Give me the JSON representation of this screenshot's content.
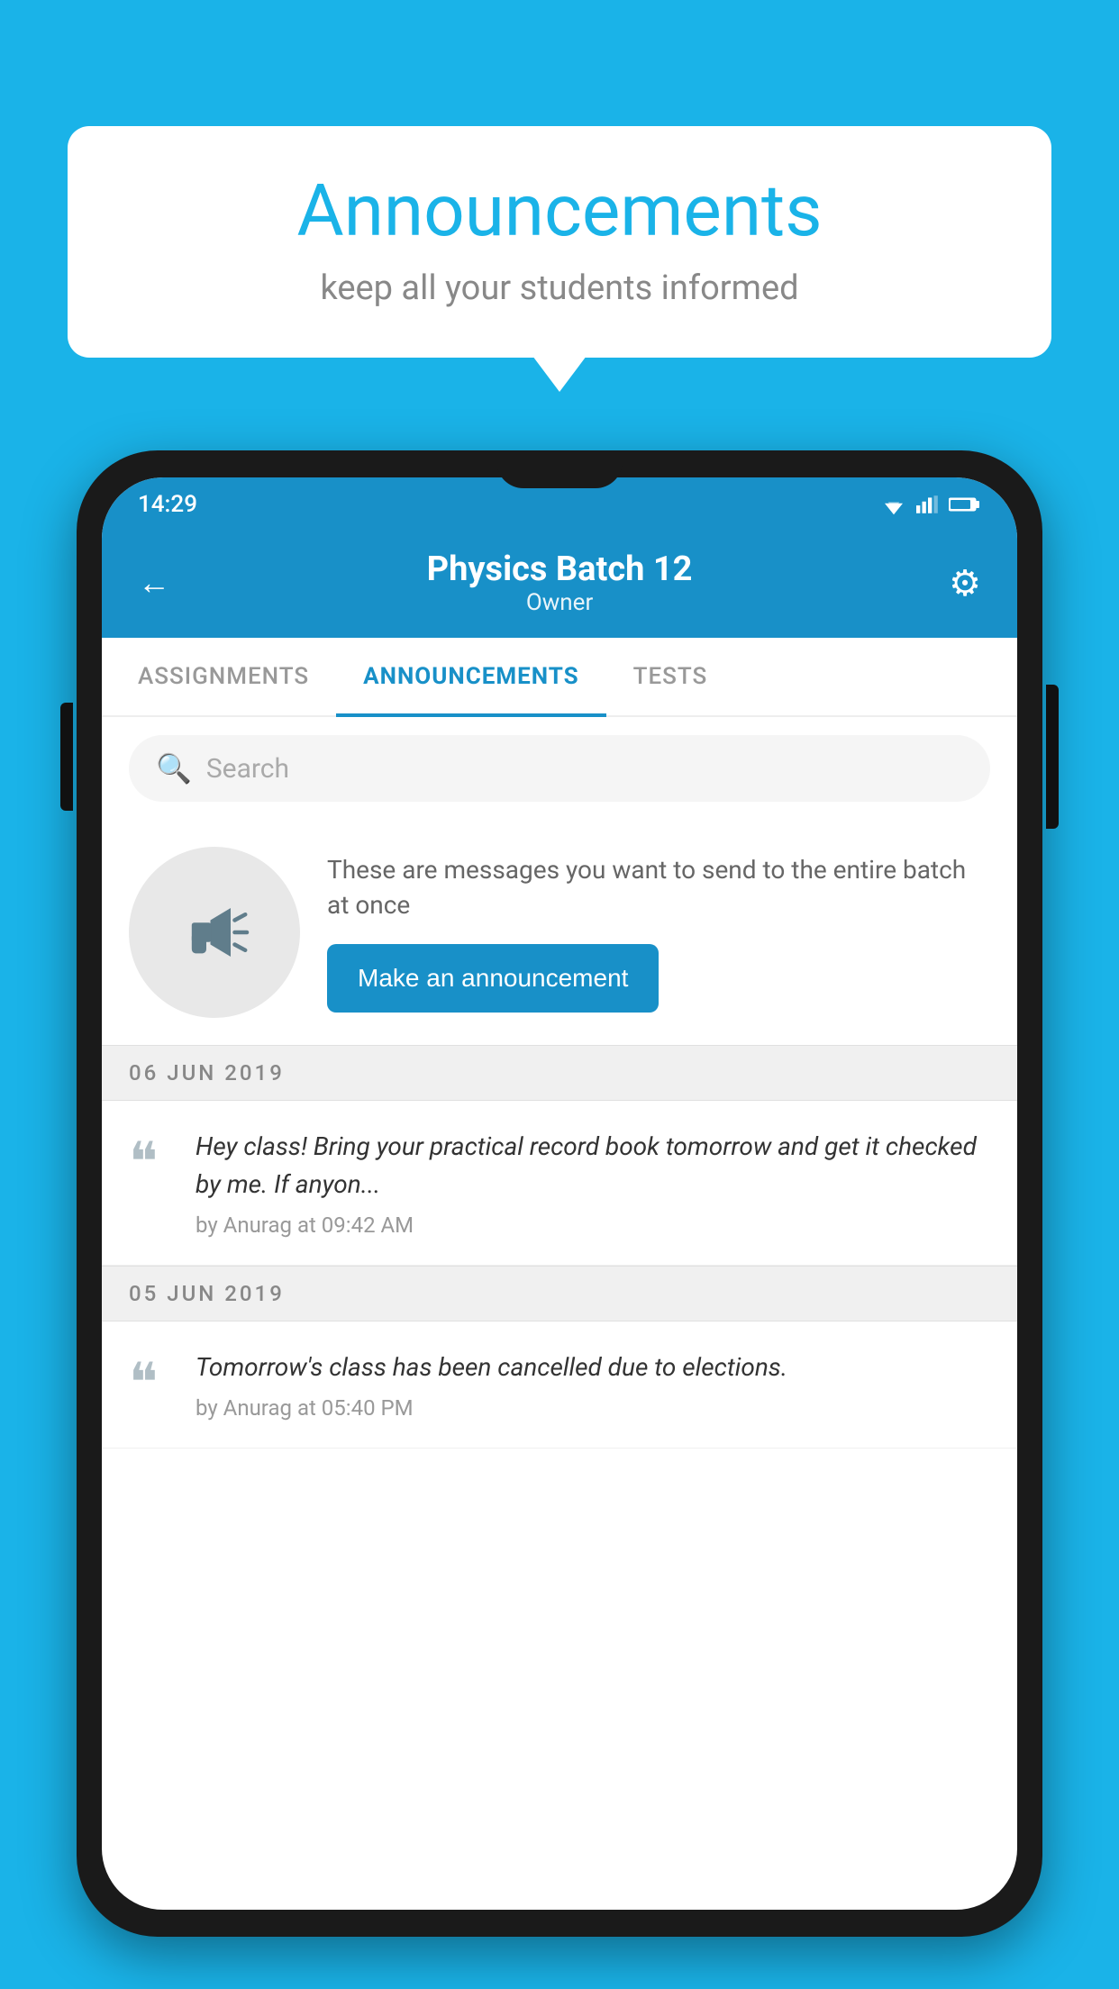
{
  "background_color": "#1ab3e8",
  "speech_bubble": {
    "title": "Announcements",
    "subtitle": "keep all your students informed"
  },
  "phone": {
    "status_bar": {
      "time": "14:29"
    },
    "header": {
      "title": "Physics Batch 12",
      "subtitle": "Owner",
      "back_label": "←",
      "gear_label": "⚙"
    },
    "tabs": [
      {
        "label": "ASSIGNMENTS",
        "active": false
      },
      {
        "label": "ANNOUNCEMENTS",
        "active": true
      },
      {
        "label": "TESTS",
        "active": false
      }
    ],
    "search": {
      "placeholder": "Search"
    },
    "promo": {
      "description": "These are messages you want to send to the entire batch at once",
      "button_label": "Make an announcement"
    },
    "announcements": [
      {
        "date": "06  JUN  2019",
        "text": "Hey class! Bring your practical record book tomorrow and get it checked by me. If anyon...",
        "meta": "by Anurag at 09:42 AM"
      },
      {
        "date": "05  JUN  2019",
        "text": "Tomorrow's class has been cancelled due to elections.",
        "meta": "by Anurag at 05:40 PM"
      }
    ]
  }
}
